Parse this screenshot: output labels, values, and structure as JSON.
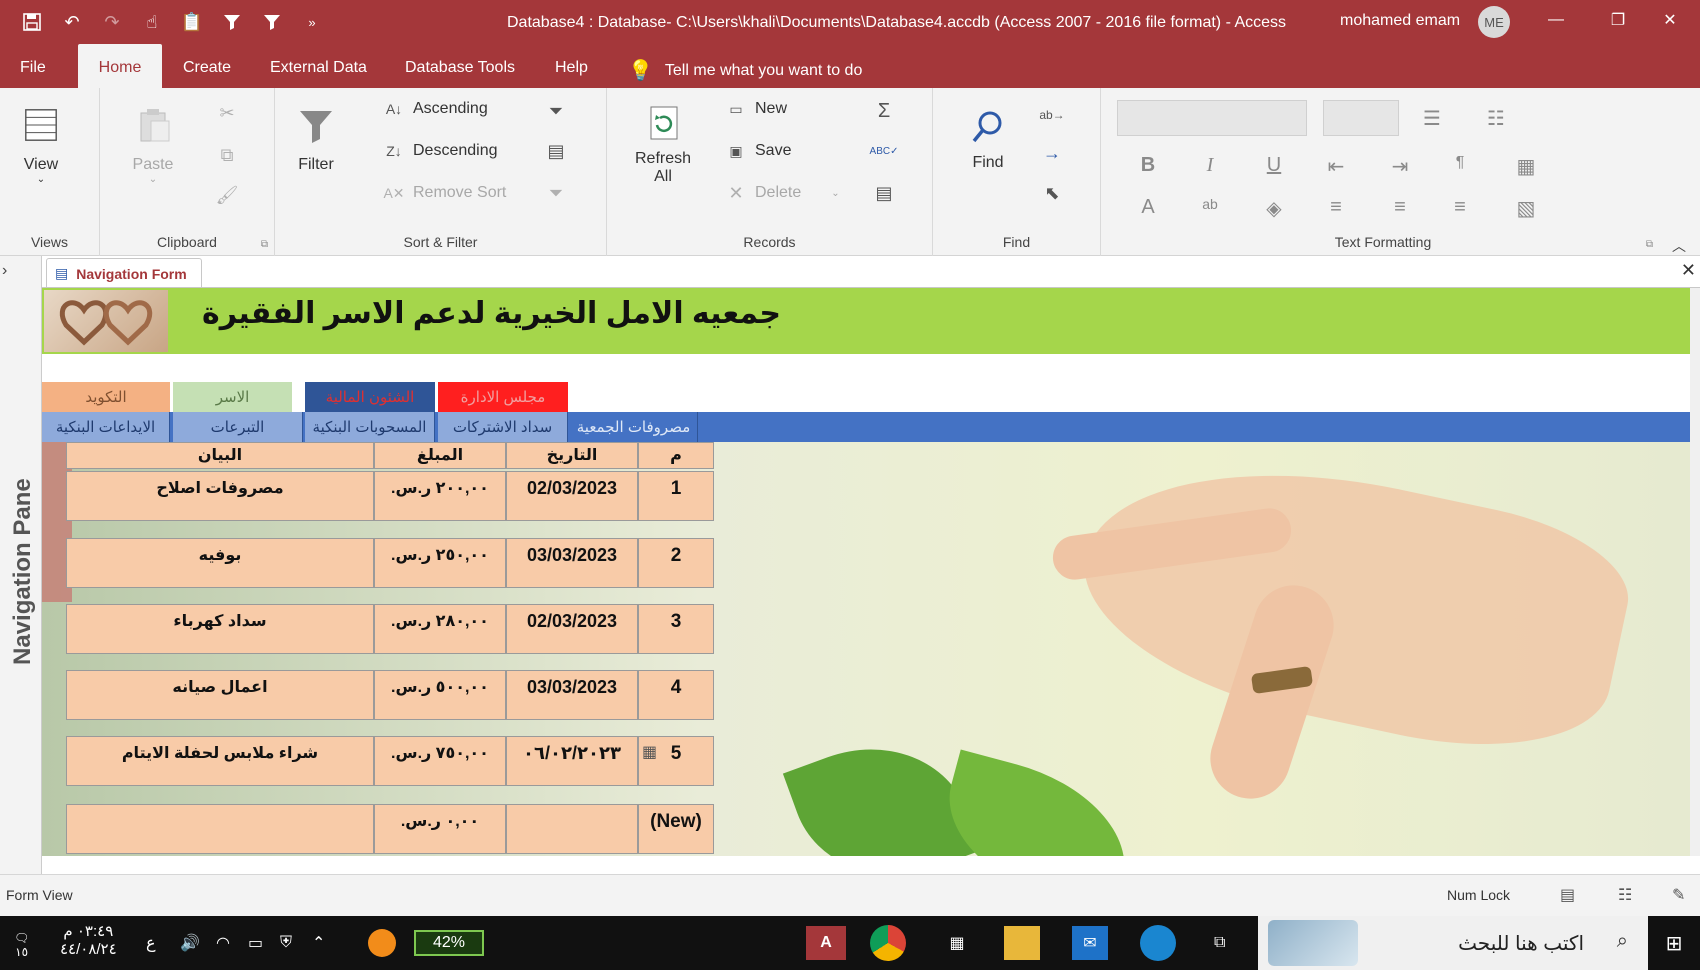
{
  "titlebar": {
    "title": "Database4 : Database- C:\\Users\\khali\\Documents\\Database4.accdb (Access 2007 - 2016 file format)  -  Access",
    "user": "mohamed emam",
    "avatar_initials": "ME"
  },
  "menu": {
    "file": "File",
    "home": "Home",
    "create": "Create",
    "external": "External Data",
    "dbtools": "Database Tools",
    "help": "Help",
    "tell_me": "Tell me what you want to do"
  },
  "ribbon": {
    "views": {
      "view": "View",
      "label": "Views"
    },
    "clipboard": {
      "paste": "Paste",
      "label": "Clipboard"
    },
    "sort": {
      "filter": "Filter",
      "ascending": "Ascending",
      "descending": "Descending",
      "remove_sort": "Remove Sort",
      "label": "Sort & Filter"
    },
    "records": {
      "refresh": "Refresh",
      "refresh_all": "All",
      "new": "New",
      "save": "Save",
      "delete": "Delete",
      "label": "Records"
    },
    "find": {
      "find": "Find",
      "label": "Find"
    },
    "text_formatting": {
      "label": "Text Formatting"
    }
  },
  "navpane": {
    "label": "Navigation Pane"
  },
  "document": {
    "tab": "Navigation Form",
    "org_title": "جمعيه الامل الخيرية لدعم الاسر الفقيرة",
    "top_tabs": [
      {
        "label": "التكويد",
        "bg": "#f4b183",
        "fg": "#7f5030"
      },
      {
        "label": "الاسر",
        "bg": "#c5e0b4",
        "fg": "#5a7a48"
      },
      {
        "label": "الشئون المالية",
        "bg": "#2f5597",
        "fg": "#e03030"
      },
      {
        "label": "مجلس الادارة",
        "bg": "#ff1f1f",
        "fg": "#f0a0a0"
      }
    ],
    "sub_tabs": [
      {
        "label": "الايداعات البنكية"
      },
      {
        "label": "التبرعات"
      },
      {
        "label": "المسحوبات البنكية"
      },
      {
        "label": "سداد الاشتركات"
      },
      {
        "label": "مصروفات الجمعية"
      }
    ],
    "table": {
      "headers": {
        "statement": "البيان",
        "amount": "المبلغ",
        "date": "التاريخ",
        "id": "م"
      },
      "rows": [
        {
          "statement": "مصروفات اصلاح",
          "amount": "٢٠٠,٠٠ ر.س.",
          "date": "02/03/2023",
          "id": "1"
        },
        {
          "statement": "بوفيه",
          "amount": "٢٥٠,٠٠ ر.س.",
          "date": "03/03/2023",
          "id": "2"
        },
        {
          "statement": "سداد كهرباء",
          "amount": "٢٨٠,٠٠ ر.س.",
          "date": "02/03/2023",
          "id": "3"
        },
        {
          "statement": "اعمال صيانه",
          "amount": "٥٠٠,٠٠ ر.س.",
          "date": "03/03/2023",
          "id": "4"
        },
        {
          "statement": "شراء ملابس لحفلة الايتام",
          "amount": "٧٥٠,٠٠ ر.س.",
          "date": "٠٦/٠٢/٢٠٢٣",
          "id": "5"
        },
        {
          "statement": "",
          "amount": "٠,٠٠ ر.س.",
          "date": "",
          "id": "(New)"
        }
      ]
    }
  },
  "status": {
    "left": "Form View",
    "numlock": "Num Lock"
  },
  "taskbar": {
    "search_placeholder": "اكتب هنا للبحث",
    "battery": "42%",
    "time": "٠٣:٤٩ م",
    "date": "٤٤/٠٨/٢٤",
    "lang": "ع",
    "badge": "١٥"
  },
  "colors": {
    "access_red": "#a4373a",
    "header_green": "#a5d64b",
    "sub_blue": "#4472c4",
    "sub_button": "#8eaadb",
    "cell_peach": "#f8cba8"
  }
}
